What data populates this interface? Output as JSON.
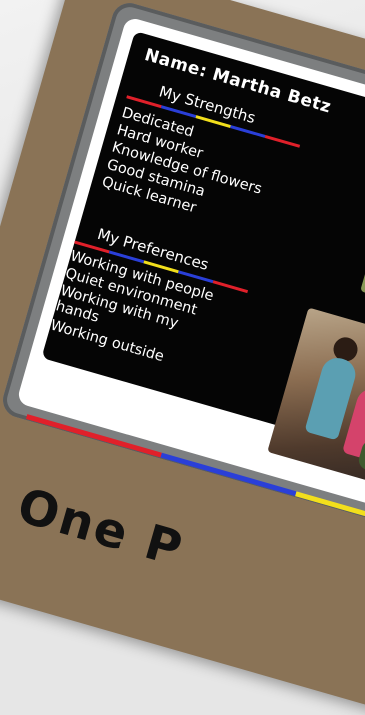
{
  "name_line": "Name: Martha Betz",
  "strengths": {
    "heading": "My Strengths",
    "items": [
      "Dedicated",
      "Hard worker",
      "Knowledge of flowers",
      "Good stamina",
      "Quick learner"
    ]
  },
  "preferences": {
    "heading": "My Preferences",
    "items": [
      "Working with people",
      "Quiet environment",
      "Working with my",
      "hands",
      "Working outside"
    ]
  },
  "poster_title": "One P",
  "colors": {
    "red": "#e0202a",
    "blue": "#2a3fd8",
    "yellow": "#f2df1c",
    "panel": "#050505",
    "poster": "#8a7356"
  }
}
